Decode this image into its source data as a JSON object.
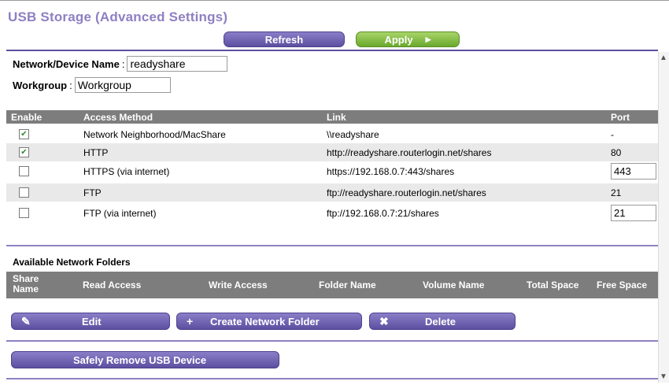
{
  "page": {
    "title": "USB Storage (Advanced Settings)",
    "refresh_label": "Refresh",
    "apply_label": "Apply"
  },
  "device": {
    "name_label": "Network/Device Name",
    "name_value": "readyshare",
    "workgroup_label": "Workgroup",
    "workgroup_value": "Workgroup"
  },
  "access_table": {
    "headers": {
      "enable": "Enable",
      "method": "Access Method",
      "link": "Link",
      "port": "Port"
    },
    "rows": [
      {
        "enabled": true,
        "method": "Network Neighborhood/MacShare",
        "link": "\\\\readyshare",
        "port": "-",
        "editable": false
      },
      {
        "enabled": true,
        "method": "HTTP",
        "link": "http://readyshare.routerlogin.net/shares",
        "port": "80",
        "editable": false
      },
      {
        "enabled": false,
        "method": "HTTPS (via internet)",
        "link": "https://192.168.0.7:443/shares",
        "port": "443",
        "editable": true
      },
      {
        "enabled": false,
        "method": "FTP",
        "link": "ftp://readyshare.routerlogin.net/shares",
        "port": "21",
        "editable": false
      },
      {
        "enabled": false,
        "method": "FTP (via internet)",
        "link": "ftp://192.168.0.7:21/shares",
        "port": "21",
        "editable": true
      }
    ]
  },
  "folders": {
    "title": "Available Network Folders",
    "headers": {
      "share_name_1": "Share",
      "share_name_2": "Name",
      "read": "Read Access",
      "write": "Write Access",
      "folder": "Folder Name",
      "volume": "Volume Name",
      "total": "Total Space",
      "free": "Free Space"
    },
    "edit_label": "Edit",
    "create_label": "Create Network Folder",
    "delete_label": "Delete"
  },
  "usb": {
    "remove_label": "Safely Remove USB Device"
  },
  "colors": {
    "accent": "#5c4fa0",
    "title": "#8f80c2",
    "apply": "#6aa92b",
    "header_bg": "#7d7d7d"
  },
  "icons": {
    "edit": "pencil-icon",
    "create": "plus-icon",
    "delete": "x-icon",
    "apply": "triangle-right-icon"
  }
}
